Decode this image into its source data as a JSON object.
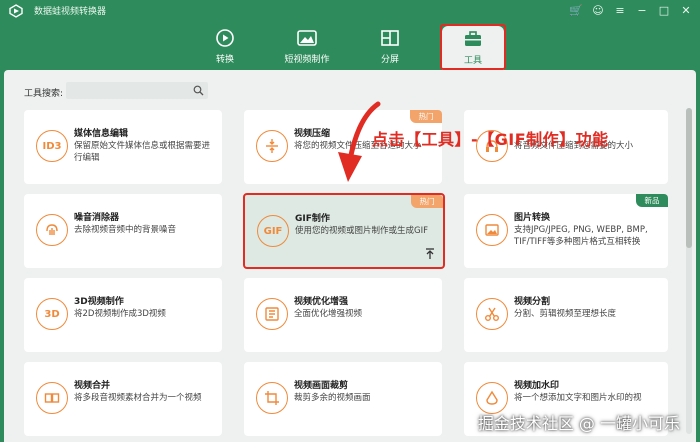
{
  "window": {
    "title": "数据蛙视频转换器"
  },
  "nav": {
    "items": [
      {
        "label": "转换"
      },
      {
        "label": "短视频制作"
      },
      {
        "label": "分屏"
      },
      {
        "label": "工具"
      }
    ]
  },
  "search": {
    "label": "工具搜索:",
    "placeholder": ""
  },
  "cards": [
    {
      "title": "媒体信息编辑",
      "desc": "保留原始文件媒体信息或根据需要进行编辑",
      "icon": "ID3"
    },
    {
      "title": "视频压缩",
      "desc": "将您的视频文件压缩至合适的大小",
      "badge": "热门"
    },
    {
      "title": "",
      "desc": "将音频文件压缩到您需要的大小"
    },
    {
      "title": "噪音消除器",
      "desc": "去除视频音频中的背景噪音"
    },
    {
      "title": "GIF制作",
      "desc": "使用您的视频或图片制作或生成GIF",
      "badge": "热门",
      "icon": "GIF"
    },
    {
      "title": "图片转换",
      "desc": "支持JPG/JPEG, PNG, WEBP, BMP, TIF/TIFF等多种图片格式互相转换",
      "badge": "新品"
    },
    {
      "title": "3D视频制作",
      "desc": "将2D视频制作成3D视频",
      "icon": "3D"
    },
    {
      "title": "视频优化增强",
      "desc": "全面优化增强视频"
    },
    {
      "title": "视频分割",
      "desc": "分割、剪辑视频至理想长度"
    },
    {
      "title": "视频合并",
      "desc": "将多段音视频素材合并为一个视频"
    },
    {
      "title": "视频画面裁剪",
      "desc": "裁剪多余的视频画面"
    },
    {
      "title": "视频加水印",
      "desc": "将一个想添加文字和图片水印的视"
    }
  ],
  "annotation": "点击【工具】-【GIF制作】功能",
  "watermark": "掘金技术社区 @ 一罐小可乐",
  "colors": {
    "brand": "#2e8b5b",
    "accent": "#f08a3b",
    "highlight": "#e02c22"
  }
}
